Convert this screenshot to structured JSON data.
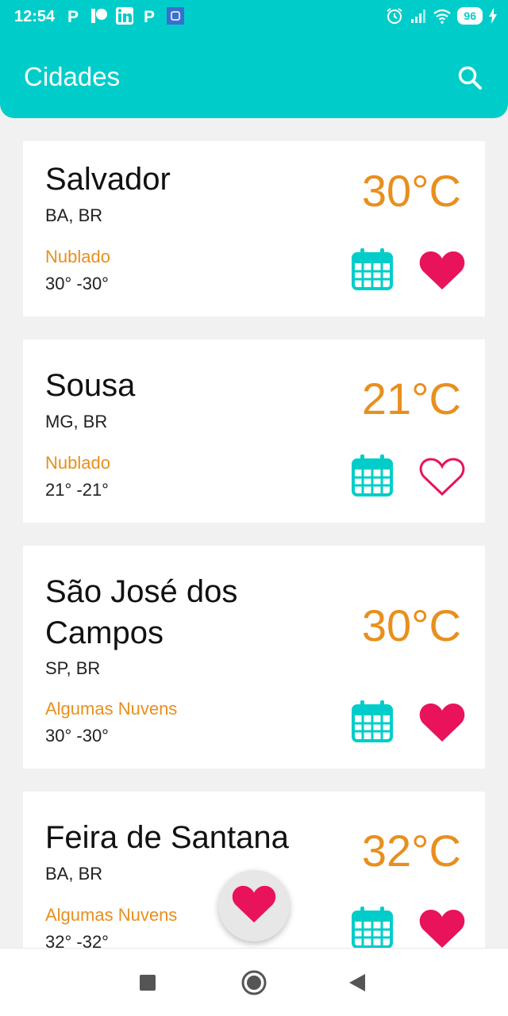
{
  "status_bar": {
    "time": "12:54",
    "battery": "96"
  },
  "app_bar": {
    "title": "Cidades"
  },
  "cities": [
    {
      "name_lines": [
        "Salvador"
      ],
      "region": "BA, BR",
      "temperature": "30°C",
      "condition": "Nublado",
      "range": "30° -30°",
      "favorite": true
    },
    {
      "name_lines": [
        "Sousa"
      ],
      "region": "MG, BR",
      "temperature": "21°C",
      "condition": "Nublado",
      "range": "21° -21°",
      "favorite": false
    },
    {
      "name_lines": [
        "São José dos",
        "Campos"
      ],
      "region": "SP, BR",
      "temperature": "30°C",
      "condition": "Algumas Nuvens",
      "range": "30° -30°",
      "favorite": true
    },
    {
      "name_lines": [
        "Feira de Santana"
      ],
      "region": "BA, BR",
      "temperature": "32°C",
      "condition": "Algumas Nuvens",
      "range": "32° -32°",
      "favorite": true
    }
  ],
  "colors": {
    "primary": "#00cdc9",
    "accent": "#e88f1d",
    "heart": "#e8135a"
  }
}
